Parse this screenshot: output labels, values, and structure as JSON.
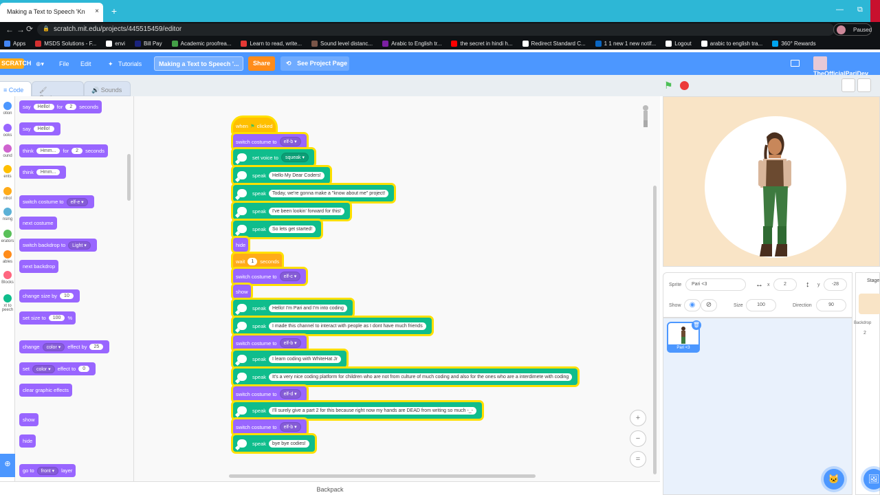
{
  "browser": {
    "tab_title": "Making a Text to Speech 'Kn",
    "tab_close": "×",
    "new_tab": "+",
    "url": "scratch.mit.edu/projects/445515459/editor",
    "profile_status": "Paused",
    "win_min": "—",
    "win_max": "⧉",
    "nav_back": "←",
    "nav_fwd": "→",
    "nav_reload": "⟳",
    "lock": "🔒",
    "bookmarks": [
      {
        "label": "Apps",
        "color": "#4285f4"
      },
      {
        "label": "MSDS Solutions - F...",
        "color": "#d32f2f"
      },
      {
        "label": "envi",
        "color": "#ffffff"
      },
      {
        "label": "Bill Pay",
        "color": "#1a237e"
      },
      {
        "label": "Academic proofrea...",
        "color": "#43a047"
      },
      {
        "label": "Learn to read, write...",
        "color": "#e53935"
      },
      {
        "label": "Sound level distanc...",
        "color": "#795548"
      },
      {
        "label": "Arabic to English tr...",
        "color": "#7b1fa2"
      },
      {
        "label": "the secret in hindi h...",
        "color": "#ff0000"
      },
      {
        "label": "Redirect Standard C...",
        "color": "#ffffff"
      },
      {
        "label": "1 1 new 1 new notif...",
        "color": "#0a66c2"
      },
      {
        "label": "Logout",
        "color": "#ffffff"
      },
      {
        "label": "arabic to english tra...",
        "color": "#ffffff"
      },
      {
        "label": "360° Rewards",
        "color": "#00a4ef"
      }
    ]
  },
  "menubar": {
    "logo": "SCRATCH",
    "globe": "⊕▾",
    "file": "File",
    "edit": "Edit",
    "tutorials": "Tutorials",
    "tutorials_icon": "✦",
    "project_title": "Making a Text to Speech '...",
    "share": "Share",
    "see_project": "See Project Page",
    "see_project_icon": "⟲",
    "username": "TheOfficialPariDev"
  },
  "tabs": {
    "code": "Code",
    "costumes": "Costumes",
    "sounds": "Sounds",
    "code_icon": "≡",
    "costumes_icon": "🖌",
    "sounds_icon": "🔊"
  },
  "categories": [
    {
      "label": "otion",
      "color": "#4c97ff"
    },
    {
      "label": "ooks",
      "color": "#9966ff"
    },
    {
      "label": "ound",
      "color": "#cf63cf"
    },
    {
      "label": "ents",
      "color": "#ffbf00"
    },
    {
      "label": "ntrol",
      "color": "#ffab19"
    },
    {
      "label": "nsing",
      "color": "#5cb1d6"
    },
    {
      "label": "erators",
      "color": "#59c059"
    },
    {
      "label": "ables",
      "color": "#ff8c1a"
    },
    {
      "label": "Blocks",
      "color": "#ff6680"
    },
    {
      "label": "xt to peech",
      "color": "#0fbd8c"
    }
  ],
  "palette": {
    "say_for": {
      "a": "say",
      "v": "Hello!",
      "b": "for",
      "n": "2",
      "c": "seconds"
    },
    "say": {
      "a": "say",
      "v": "Hello!"
    },
    "think_for": {
      "a": "think",
      "v": "Hmm...",
      "b": "for",
      "n": "2",
      "c": "seconds"
    },
    "think": {
      "a": "think",
      "v": "Hmm..."
    },
    "switch_costume": {
      "a": "switch costume to",
      "v": "elf-e ▾"
    },
    "next_costume": "next costume",
    "switch_backdrop": {
      "a": "switch backdrop to",
      "v": "Light ▾"
    },
    "next_backdrop": "next backdrop",
    "change_size": {
      "a": "change size by",
      "v": "10"
    },
    "set_size": {
      "a": "set size to",
      "v": "100",
      "b": "%"
    },
    "change_effect": {
      "a": "change",
      "v": "color ▾",
      "b": "effect by",
      "n": "25"
    },
    "set_effect": {
      "a": "set",
      "v": "color ▾",
      "b": "effect to",
      "n": "0"
    },
    "clear_effects": "clear graphic effects",
    "show": "show",
    "hide": "hide",
    "goto_layer": {
      "a": "go to",
      "v": "front ▾",
      "b": "layer"
    }
  },
  "script": {
    "when": "when",
    "flag": "⚑",
    "clicked": "clicked",
    "switch_costume": "switch costume to",
    "set_voice": "set voice to",
    "speak": "speak",
    "hide": "hide",
    "wait": "wait",
    "seconds": "seconds",
    "show": "show",
    "costume1": "elf-b ▾",
    "voice": "squeak ▾",
    "s1": "Hello My Dear Coders!",
    "s2": "Today, we're gonna make a \"know about me\" project!",
    "s3": "I've been lookin' forward for this!",
    "s4": "So lets get started!",
    "wait_n": "1",
    "costume2": "elf-c ▾",
    "s5": "Hello! I'm Pari and I'm into coding",
    "s6": "I made this channel to interact with people as I dont have much friends",
    "costume3": "elf-b ▾",
    "s7": "I learn coding with WhiteHat Jr",
    "s8": "It's a very nice coding platform for children who are not from culture of much coding and also for the ones who are a interdimete with coding",
    "costume4": "elf-d ▾",
    "s9": "I'll surely give a part 2 for this because right now my hands are DEAD from writing so much -_-",
    "costume5": "elf-b ▾",
    "s10": "bye bye codies!"
  },
  "zoom": {
    "in": "+",
    "out": "−",
    "reset": "="
  },
  "backpack": "Backpack",
  "sprite_info": {
    "sprite_label": "Sprite",
    "sprite_name": "Pari <3",
    "x_icon": "↔",
    "x_label": "x",
    "x": "2",
    "y_icon": "↕",
    "y_label": "y",
    "y": "-28",
    "show_label": "Show",
    "show_icon": "◉",
    "hide_icon": "⊘",
    "size_label": "Size",
    "size": "100",
    "direction_label": "Direction",
    "direction": "90"
  },
  "sprite_list": {
    "thumb_label": "Pari <3",
    "delete_icon": "🗑"
  },
  "stage_pane": {
    "label": "Stage",
    "backdrops_label": "Backdrop",
    "backdrops_count": "2"
  },
  "fab": {
    "sprite": "🐱",
    "stage": "🖼"
  },
  "add_extension": "⊕",
  "colors": {
    "scratch_blue": "#4c97ff",
    "looks": "#9966ff",
    "events": "#ffbf00",
    "control": "#ffab19",
    "tts": "#0fbd8c",
    "highlight": "#ffe000"
  }
}
